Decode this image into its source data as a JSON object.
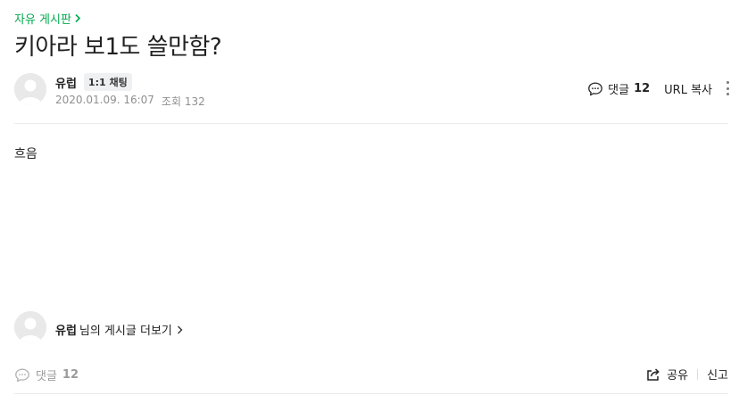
{
  "board": {
    "name": "자유 게시판"
  },
  "post": {
    "title": "키아라 보1도 쓸만함?",
    "author": "유럽",
    "chat_badge": "1:1 채팅",
    "date": "2020.01.09. 16:07",
    "views_label": "조회 132",
    "body": "흐음"
  },
  "tools": {
    "comments_label": "댓글",
    "comments_count": "12",
    "copy_url": "URL 복사"
  },
  "more_posts": {
    "author": "유럽",
    "suffix": "님의 게시글 더보기"
  },
  "footer": {
    "comments_label": "댓글",
    "comments_count": "12",
    "share": "공유",
    "report": "신고"
  },
  "colors": {
    "accent": "#03a94e",
    "meta": "#8f8f8f"
  }
}
